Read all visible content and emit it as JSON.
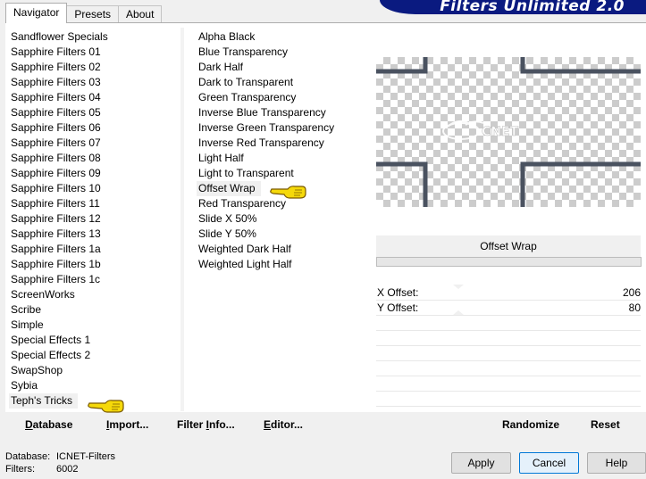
{
  "tabs": [
    {
      "label": "Navigator",
      "active": true
    },
    {
      "label": "Presets",
      "active": false
    },
    {
      "label": "About",
      "active": false
    }
  ],
  "banner": {
    "title": "Filters Unlimited 2.0",
    "color": "#0a1a80"
  },
  "categories": {
    "items": [
      "Sandflower Specials",
      "Sapphire Filters 01",
      "Sapphire Filters 02",
      "Sapphire Filters 03",
      "Sapphire Filters 04",
      "Sapphire Filters 05",
      "Sapphire Filters 06",
      "Sapphire Filters 07",
      "Sapphire Filters 08",
      "Sapphire Filters 09",
      "Sapphire Filters 10",
      "Sapphire Filters 11",
      "Sapphire Filters 12",
      "Sapphire Filters 13",
      "Sapphire Filters 1a",
      "Sapphire Filters 1b",
      "Sapphire Filters 1c",
      "ScreenWorks",
      "Scribe",
      "Simple",
      "Special Effects 1",
      "Special Effects 2",
      "SwapShop",
      "Sybia",
      "Teph's Tricks"
    ],
    "selected": "Teph's Tricks"
  },
  "filters": {
    "items": [
      "Alpha Black",
      "Blue Transparency",
      "Dark Half",
      "Dark to Transparent",
      "Green Transparency",
      "Inverse Blue Transparency",
      "Inverse Green Transparency",
      "Inverse Red Transparency",
      "Light Half",
      "Light to Transparent",
      "Offset Wrap",
      "Red Transparency",
      "Slide X 50%",
      "Slide Y 50%",
      "Weighted Dark Half",
      "Weighted Light Half"
    ],
    "selected": "Offset Wrap"
  },
  "preview": {
    "filter_name": "Offset Wrap",
    "frame_color": "#4a5260"
  },
  "params": [
    {
      "label": "X Offset:",
      "value": "206"
    },
    {
      "label": "Y Offset:",
      "value": "80"
    }
  ],
  "toolbar": {
    "database": {
      "u": "D",
      "rest": "atabase"
    },
    "import": {
      "u": "I",
      "rest": "mport..."
    },
    "filter_info": {
      "pre": "Filter ",
      "u": "I",
      "rest": "nfo..."
    },
    "editor": {
      "u": "E",
      "rest": "ditor..."
    },
    "randomize": "Randomize",
    "reset": "Reset"
  },
  "status": {
    "database_label": "Database:",
    "database_value": "ICNET-Filters",
    "filters_label": "Filters:",
    "filters_value": "6002"
  },
  "buttons": {
    "apply": "Apply",
    "cancel": "Cancel",
    "help": "Help"
  },
  "colors": {
    "pointer": "#f5d90a",
    "pointer_outline": "#7a5a00",
    "accent": "#0078d7"
  }
}
